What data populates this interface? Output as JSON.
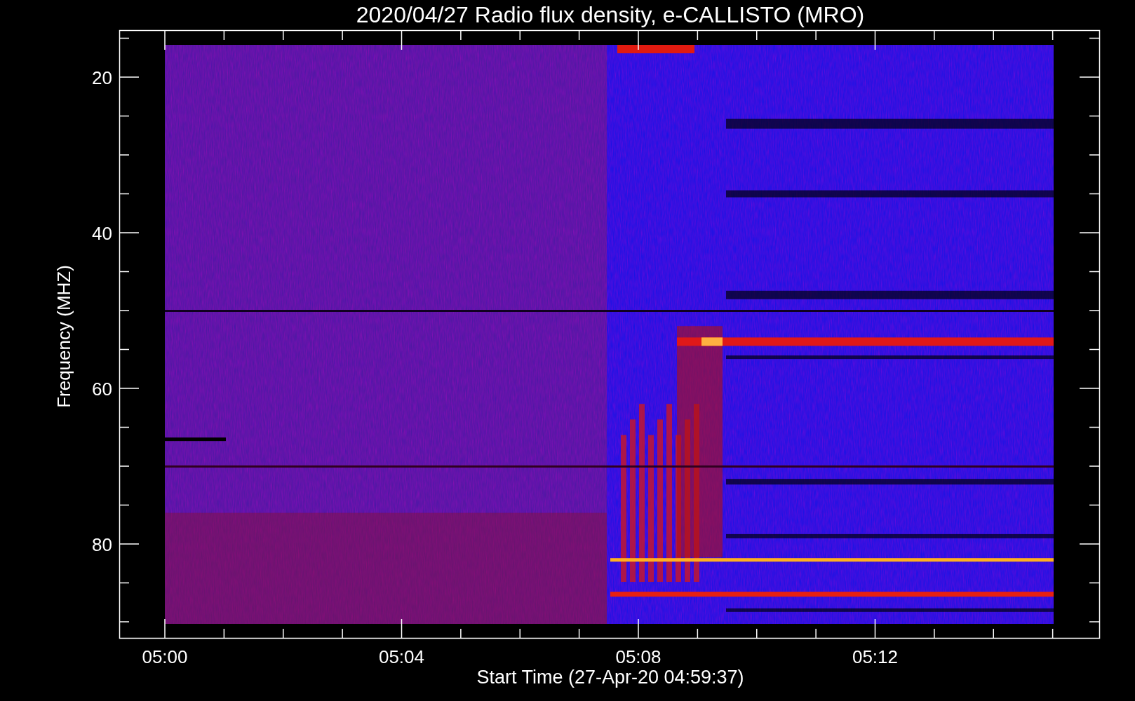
{
  "title": "2020/04/27  Radio flux density, e-CALLISTO (MRO)",
  "x_axis": {
    "label": "Start Time (27-Apr-20 04:59:37)",
    "ticks": [
      "05:00",
      "05:04",
      "05:08",
      "05:12"
    ]
  },
  "y_axis": {
    "label": "Frequency (MHZ)",
    "ticks": [
      "20",
      "40",
      "60",
      "80"
    ]
  }
}
